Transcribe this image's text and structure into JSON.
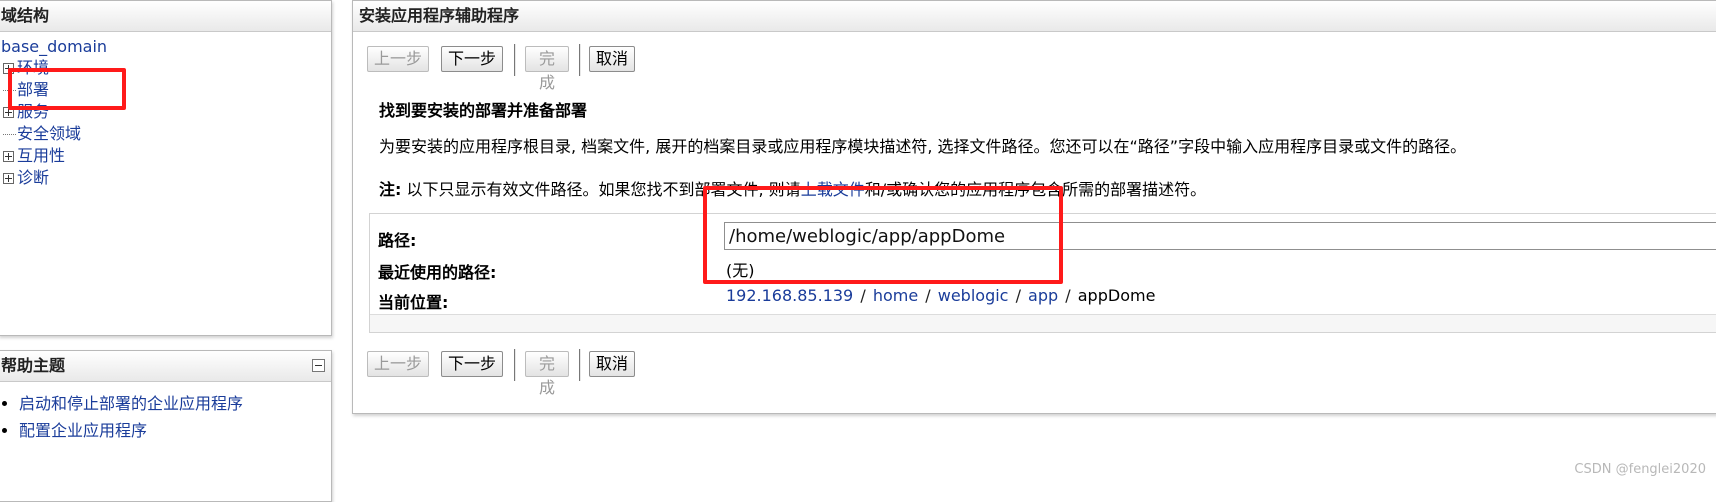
{
  "domain_panel": {
    "title": "域结构",
    "root": "base_domain",
    "items": [
      {
        "label": "环境",
        "expandable": true
      },
      {
        "label": "部署",
        "expandable": false
      },
      {
        "label": "服务",
        "expandable": true
      },
      {
        "label": "安全领域",
        "expandable": false
      },
      {
        "label": "互用性",
        "expandable": true
      },
      {
        "label": "诊断",
        "expandable": true
      }
    ]
  },
  "help_panel": {
    "title": "帮助主题",
    "items": [
      "启动和停止部署的企业应用程序",
      "配置企业应用程序"
    ]
  },
  "wizard": {
    "title": "安装应用程序辅助程序",
    "buttons": {
      "back": "上一步",
      "next": "下一步",
      "finish": "完成",
      "cancel": "取消"
    },
    "section_title": "找到要安装的部署并准备部署",
    "description": "为要安装的应用程序根目录, 档案文件, 展开的档案目录或应用程序模块描述符, 选择文件路径。您还可以在“路径”字段中输入应用程序目录或文件的路径。",
    "note": {
      "label": "注:",
      "text_before": "以下只显示有效文件路径。如果您找不到部署文件, 则请",
      "link": "上载文件",
      "text_after": "和/或确认您的应用程序包含所需的部署描述符。"
    },
    "form": {
      "path_label": "路径:",
      "path_value": "/home/weblogic/app/appDome",
      "recent_label": "最近使用的路径:",
      "recent_value": "(无)",
      "location_label": "当前位置:",
      "location": {
        "parts": [
          "192.168.85.139",
          "home",
          "weblogic",
          "app"
        ],
        "current": "appDome",
        "separator": "/"
      }
    }
  },
  "watermark": "CSDN @fenglei2020",
  "colors": {
    "link": "#1a3c9a",
    "highlight": "#ff1a1a"
  }
}
